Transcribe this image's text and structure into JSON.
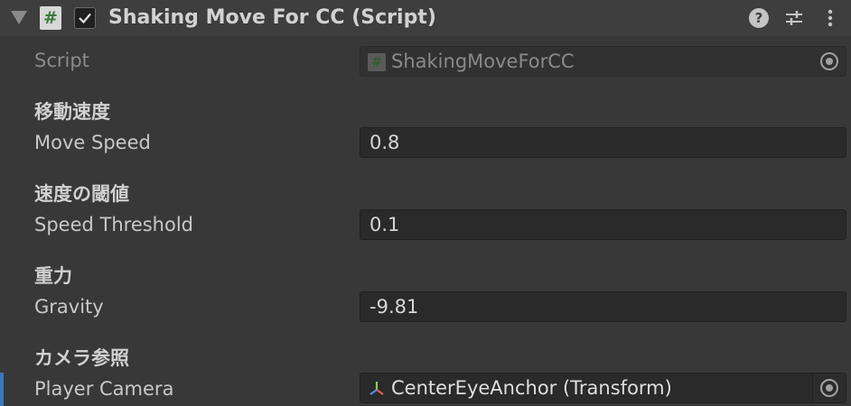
{
  "component": {
    "title": "Shaking Move For CC (Script)",
    "icon_glyph": "#",
    "enabled": true
  },
  "fields": {
    "script": {
      "label": "Script",
      "value": "ShakingMoveForCC",
      "icon_glyph": "#"
    },
    "move_speed": {
      "header": "移動速度",
      "label": "Move Speed",
      "value": "0.8"
    },
    "speed_threshold": {
      "header": "速度の閾値",
      "label": "Speed Threshold",
      "value": "0.1"
    },
    "gravity": {
      "header": "重力",
      "label": "Gravity",
      "value": "-9.81"
    },
    "player_camera": {
      "header": "カメラ参照",
      "label": "Player Camera",
      "value": "CenterEyeAnchor (Transform)"
    }
  },
  "icons": {
    "help": "help-icon",
    "presets": "presets-icon",
    "menu": "kebab-menu-icon",
    "transform": "transform-icon",
    "object_picker": "object-picker-icon"
  },
  "colors": {
    "background": "#383838",
    "header": "#3e3e3e",
    "field": "#2a2a2a",
    "selection": "#3a79bb"
  }
}
